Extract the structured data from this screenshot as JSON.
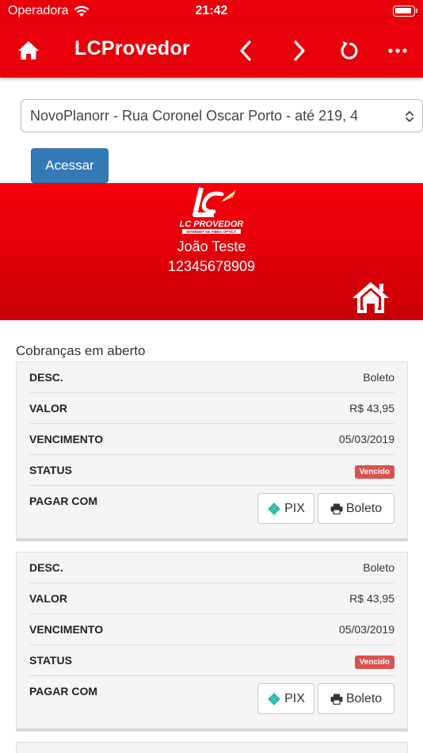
{
  "status_bar": {
    "carrier": "Operadora",
    "time": "21:42"
  },
  "nav": {
    "title": "LCProvedor"
  },
  "plan_select": {
    "selected": "NovoPlanorr - Rua Coronel Oscar Porto - até 219, 4"
  },
  "access_button": {
    "label": "Acessar"
  },
  "profile": {
    "logo_text": "LC PROVEDOR",
    "logo_tagline": "INTERNET DE FIBRA ÓPTICA",
    "name": "João Teste",
    "document": "12345678909"
  },
  "section": {
    "title": "Cobranças em aberto"
  },
  "labels": {
    "desc": "DESC.",
    "valor": "VALOR",
    "vencimento": "VENCIMENTO",
    "status": "STATUS",
    "pagar_com": "PAGAR COM",
    "pix": "PIX",
    "boleto": "Boleto"
  },
  "charges": [
    {
      "desc": "Boleto",
      "valor": "R$ 43,95",
      "vencimento": "05/03/2019",
      "status": "Vencido"
    },
    {
      "desc": "Boleto",
      "valor": "R$ 43,95",
      "vencimento": "05/03/2019",
      "status": "Vencido"
    }
  ],
  "colors": {
    "brand_red": "#e8000b",
    "access_blue": "#337ab7",
    "badge_red": "#d9534f",
    "pix_teal": "#32bcad"
  }
}
